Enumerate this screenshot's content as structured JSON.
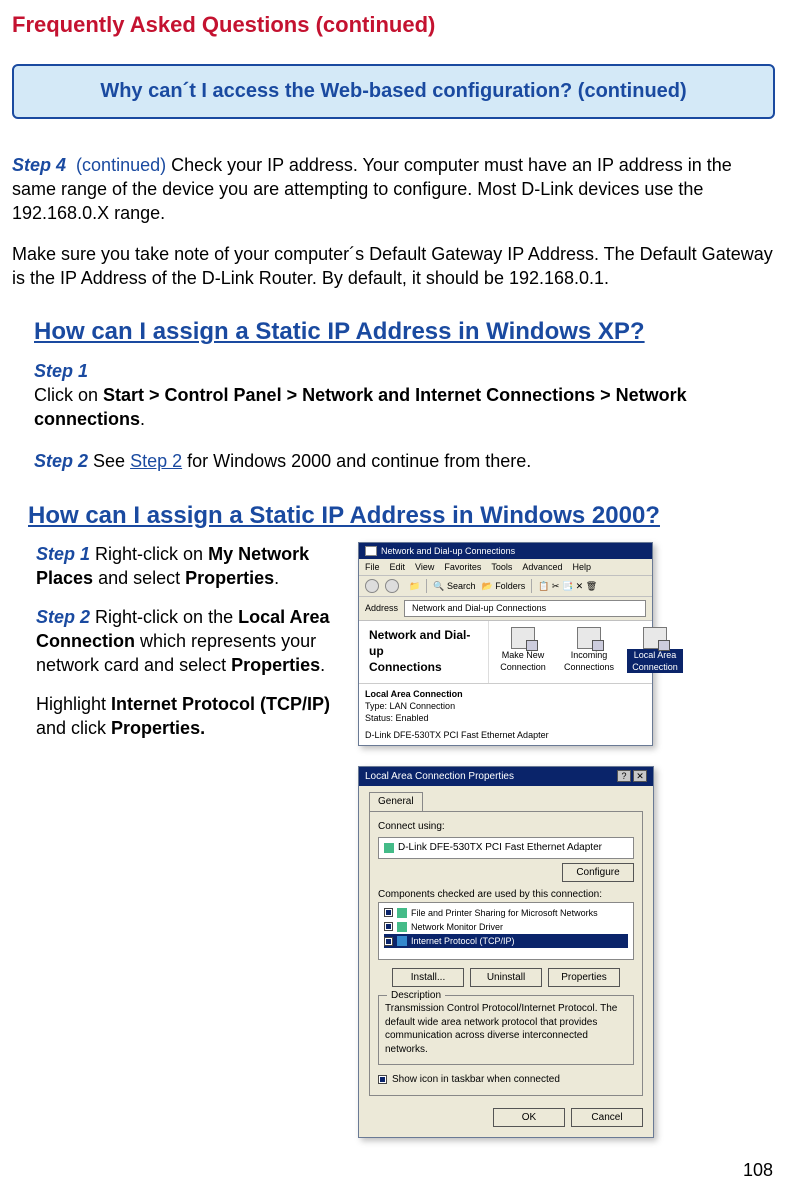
{
  "page": {
    "title": "Frequently Asked Questions (continued)",
    "number": "108"
  },
  "callout": {
    "text": "Why can´t I access the Web-based configuration? (continued)"
  },
  "step4": {
    "label": "Step 4",
    "continued": "(continued)",
    "text1_tail": " Check your IP address. Your computer must have an IP address in the same range of the device you are attempting to configure. Most D-Link devices use the 192.168.0.X range.",
    "text2": "Make sure you take note of your computer´s Default Gateway IP Address. The Default Gateway is the IP Address of the D-Link Router. By default, it should be 192.168.0.1."
  },
  "xp": {
    "heading": "How can I assign a Static IP Address in Windows XP?",
    "step1_label": "Step 1",
    "step1_line1": "Click on ",
    "step1_bold": "Start > Control Panel > Network and Internet Connections > Network connections",
    "step1_tail": ".",
    "step2_label": "Step 2",
    "step2_pre": " See ",
    "step2_link": "Step 2",
    "step2_post": " for Windows 2000 and continue from there."
  },
  "w2k": {
    "heading": "How can I assign a Static IP Address in Windows 2000?",
    "s1_label": "Step 1",
    "s1_a": " Right-click on ",
    "s1_b": "My Network Places",
    "s1_c": " and select ",
    "s1_d": "Properties",
    "s1_e": ".",
    "s2_label": "Step 2",
    "s2_a": " Right-click on the ",
    "s2_b": "Local Area Connection",
    "s2_c": " which represents your network card and select ",
    "s2_d": "Properties",
    "s2_e": ".",
    "h_a": "Highlight ",
    "h_b": "Internet Protocol (TCP/IP)",
    "h_c": " and click ",
    "h_d": "Properties."
  },
  "shot1": {
    "title": "Network and Dial-up Connections",
    "menus": [
      "File",
      "Edit",
      "View",
      "Favorites",
      "Tools",
      "Advanced",
      "Help"
    ],
    "back": "←",
    "search": "Search",
    "folders": "Folders",
    "address_label": "Address",
    "address_text": "Network and Dial-up Connections",
    "left_title1": "Network and Dial-up",
    "left_title2": "Connections",
    "conn_make": "Make New Connection",
    "conn_incoming": "Incoming Connections",
    "conn_lac": "Local Area Connection",
    "footer_name": "Local Area Connection",
    "footer_type_l": "Type:",
    "footer_type_v": "LAN Connection",
    "footer_status_l": "Status:",
    "footer_status_v": "Enabled",
    "footer_adapter": "D-Link DFE-530TX PCI Fast Ethernet Adapter"
  },
  "shot2": {
    "title": "Local Area Connection Properties",
    "tab": "General",
    "connect_using": "Connect using:",
    "adapter": "D-Link DFE-530TX PCI Fast Ethernet Adapter",
    "configure": "Configure",
    "components_label": "Components checked are used by this connection:",
    "comp1": "File and Printer Sharing for Microsoft Networks",
    "comp2": "Network Monitor Driver",
    "comp3": "Internet Protocol (TCP/IP)",
    "install": "Install...",
    "uninstall": "Uninstall",
    "properties": "Properties",
    "desc_label": "Description",
    "desc_text": "Transmission Control Protocol/Internet Protocol. The default wide area network protocol that provides communication across diverse interconnected networks.",
    "show_icon": "Show icon in taskbar when connected",
    "ok": "OK",
    "cancel": "Cancel"
  }
}
